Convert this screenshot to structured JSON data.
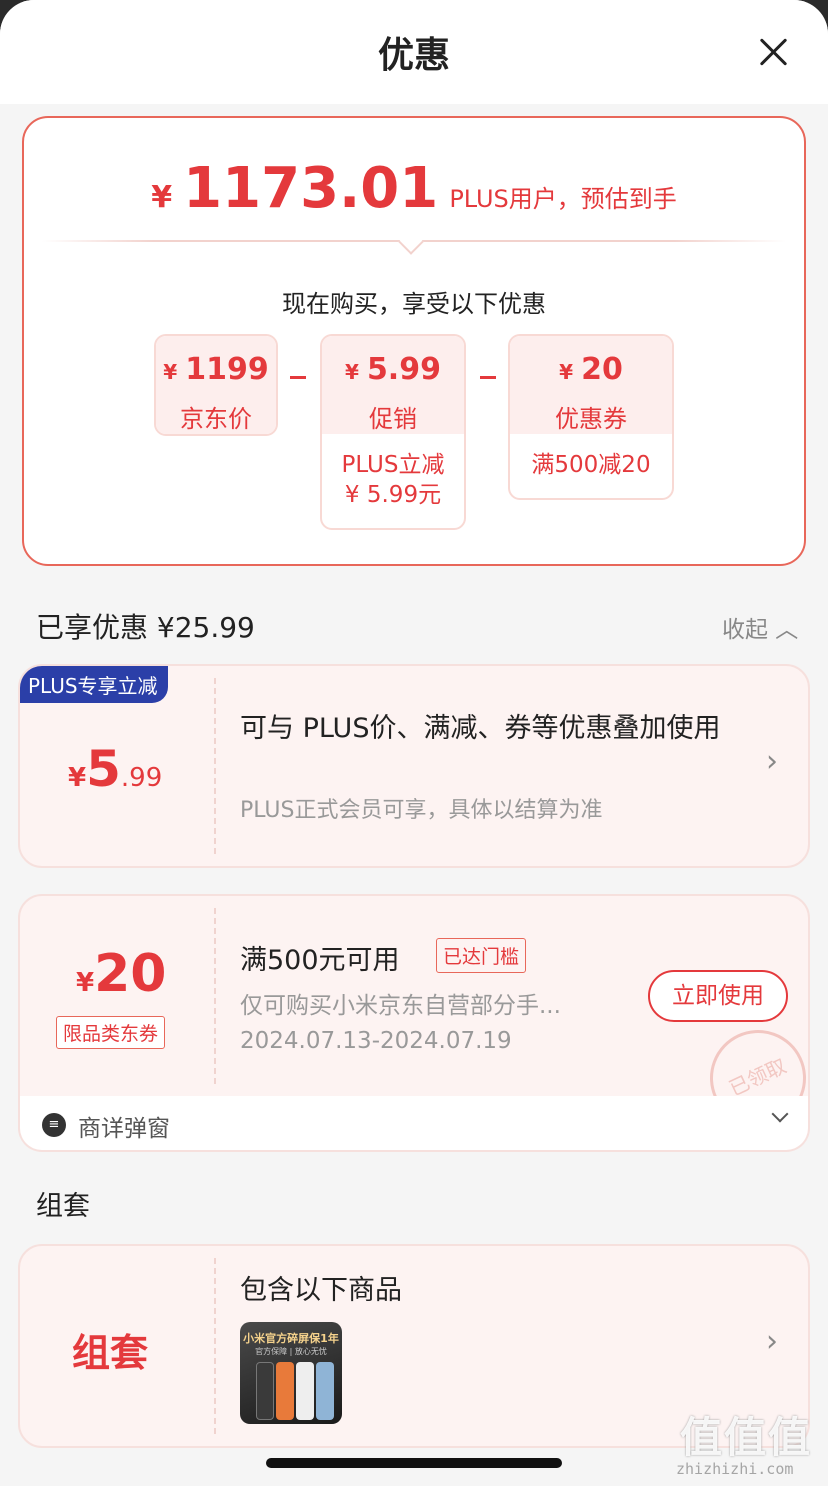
{
  "header": {
    "title": "优惠"
  },
  "summary": {
    "currency": "¥",
    "final_price": "1173.01",
    "final_desc": "PLUS用户，预估到手",
    "subtitle": "现在购买，享受以下优惠",
    "chips": [
      {
        "currency": "¥",
        "value": "1199",
        "label": "京东价"
      },
      {
        "currency": "¥",
        "value": "5.99",
        "label": "促销",
        "note_line1": "PLUS立减",
        "note_line2": "¥ 5.99元"
      },
      {
        "currency": "¥",
        "value": "20",
        "label": "优惠券",
        "note_line1": "满500减20"
      }
    ]
  },
  "enjoyed": {
    "label": "已享优惠 ¥25.99",
    "collapse": "收起 ︿"
  },
  "plus_card": {
    "badge": "PLUS专享立减",
    "currency": "¥",
    "price_int": "5",
    "price_dec": ".99",
    "title": "可与 PLUS价、满减、券等优惠叠加使用",
    "subtitle": "PLUS正式会员可享，具体以结算为准",
    "chevron": "›"
  },
  "coupon_card": {
    "currency": "¥",
    "value": "20",
    "tag": "限品类东券",
    "title": "满500元可用",
    "reached": "已达门槛",
    "desc": "仅可购买小米京东自营部分手...",
    "date": "2024.07.13-2024.07.19",
    "button": "立即使用",
    "stamp": "已领取"
  },
  "detail_bar": {
    "icon": "≡",
    "label": "商详弹窗"
  },
  "bundle": {
    "section_title": "组套",
    "label": "组套",
    "title": "包含以下商品",
    "thumb_text": "小米官方碎屏保1年",
    "thumb_sub": "官方保障 | 放心无忧",
    "chevron": "›"
  },
  "watermark": {
    "text": "值值值",
    "url": "zhizhizhi.com"
  },
  "colors": {
    "accent": "#e4393c",
    "plus_badge": "#2b3fa8"
  }
}
